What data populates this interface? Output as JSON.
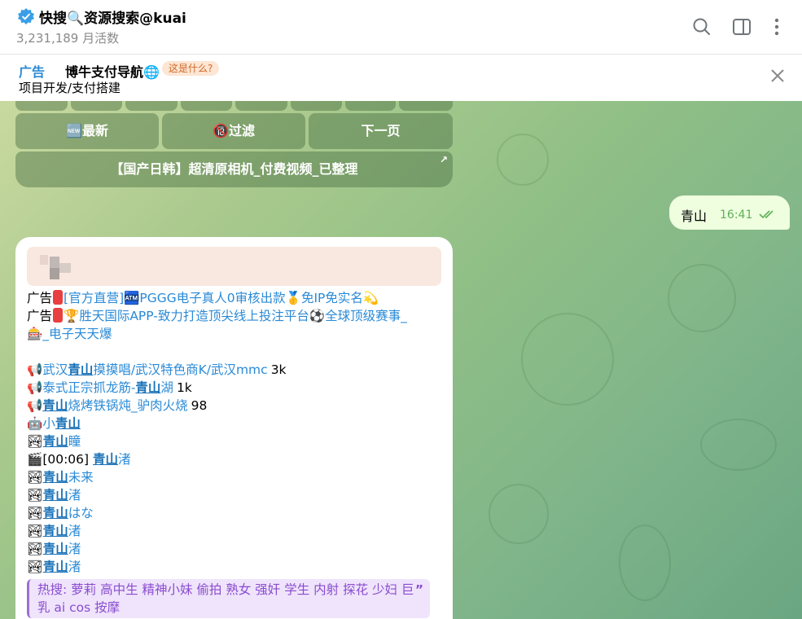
{
  "header": {
    "title": "快搜🔍资源搜索@kuai",
    "subtitle": "3,231,189 月活数",
    "icons": [
      "search-icon",
      "sidebar-icon",
      "more-icon"
    ]
  },
  "ad": {
    "label": "广告",
    "title": "博牛支付导航🌐",
    "what": "这是什么?",
    "subtitle": "项目开发/支付搭建"
  },
  "keyboard": {
    "buttons": [
      "🆕最新",
      "🔞过滤",
      "下一页"
    ],
    "wide_button": "【国产日韩】超清原相机_付费视频_已整理",
    "wide_arrow": "↗"
  },
  "outgoing": {
    "text": "青山",
    "time": "16:41"
  },
  "incoming": {
    "ad_lines": [
      {
        "prefix": "广告",
        "text": "[官方直营]🏧PGGG电子真人0审核出款🥇免IP免实名💫"
      },
      {
        "prefix": "广告",
        "text": "🏆胜天国际APP-致力打造顶尖线上投注平台⚽全球顶级赛事_"
      },
      {
        "prefix": "",
        "text": "🎰_电子天天爆"
      }
    ],
    "results": [
      {
        "icon": "📢",
        "before": "武汉",
        "kw": "青山",
        "after": "摸摸唱/武汉特色商K/武汉mmc",
        "count": "3k"
      },
      {
        "icon": "📢",
        "before": "泰式正宗抓龙筋-",
        "kw": "青山",
        "after": "湖",
        "count": "1k"
      },
      {
        "icon": "📢",
        "before": "",
        "kw": "青山",
        "after": "烧烤铁锅炖_驴肉火烧",
        "count": "98"
      },
      {
        "icon": "🤖",
        "before": "小",
        "kw": "青山",
        "after": "",
        "count": ""
      },
      {
        "icon": "🏞",
        "before": "",
        "kw": "青山",
        "after": "瞳",
        "count": ""
      },
      {
        "icon": "🎬",
        "before": "[00:06] ",
        "kw": "青山",
        "after": "渚",
        "count": ""
      },
      {
        "icon": "🏞",
        "before": "",
        "kw": "青山",
        "after": "未来",
        "count": ""
      },
      {
        "icon": "🏞",
        "before": "",
        "kw": "青山",
        "after": "渚",
        "count": ""
      },
      {
        "icon": "🏞",
        "before": "",
        "kw": "青山",
        "after": "はな",
        "count": ""
      },
      {
        "icon": "🏞",
        "before": "",
        "kw": "青山",
        "after": "渚",
        "count": ""
      },
      {
        "icon": "🏞",
        "before": "",
        "kw": "青山",
        "after": "渚",
        "count": ""
      },
      {
        "icon": "🏞",
        "before": "",
        "kw": "青山",
        "after": "渚",
        "count": ""
      }
    ],
    "hot_line1": "热搜: 萝莉 高中生 精神小妹 偷拍 熟女 强奸 学生 内射 探花 少妇 巨",
    "hot_line2": "乳 ai cos 按摩"
  },
  "colors": {
    "accent": "#2a8ad6",
    "outgoing_bg": "#eefedf",
    "hot_bg": "#efe4fb",
    "hot_text": "#8a4cd0"
  }
}
